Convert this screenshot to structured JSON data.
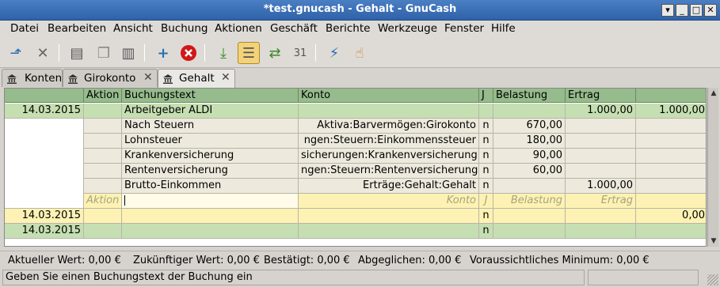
{
  "window": {
    "title": "*test.gnucash - Gehalt - GnuCash"
  },
  "colors": {
    "title_bar": "#3b6fb5",
    "header_green": "#96bb8c",
    "row_green": "#c6dfb2",
    "split_row": "#ede9dc",
    "input_row": "#fdf2b3",
    "close_red": "#d01818"
  },
  "menu": [
    "Datei",
    "Bearbeiten",
    "Ansicht",
    "Buchung",
    "Aktionen",
    "Geschäft",
    "Berichte",
    "Werkzeuge",
    "Fenster",
    "Hilfe"
  ],
  "toolbar_icons": [
    "save-icon",
    "close-icon",
    "new-invoice-icon",
    "duplicate-icon",
    "print-icon",
    "add-icon",
    "delete-icon",
    "enter-icon",
    "split-view-icon",
    "jump-icon",
    "schedule-icon",
    "transfer-icon",
    "reconcile-icon"
  ],
  "tabs": [
    {
      "label": "Konten"
    },
    {
      "label": "Girokonto"
    },
    {
      "label": "Gehalt"
    }
  ],
  "register": {
    "columns": [
      "",
      "Aktion",
      "Buchungstext",
      "Konto",
      "J",
      "Belastung",
      "Ertrag",
      ""
    ],
    "rows": [
      {
        "type": "transaction",
        "date": "14.03.2015",
        "action": "",
        "desc": "Arbeitgeber ALDI",
        "account": "",
        "r": "",
        "debit": "",
        "credit": "1.000,00",
        "balance": "1.000,00"
      },
      {
        "type": "split",
        "action": "",
        "desc": "Nach Steuern",
        "account": "Aktiva:Barvermögen:Girokonto",
        "r": "n",
        "debit": "670,00",
        "credit": ""
      },
      {
        "type": "split",
        "action": "",
        "desc": "Lohnsteuer",
        "account": "ngen:Steuern:Einkommenssteuer",
        "r": "n",
        "debit": "180,00",
        "credit": ""
      },
      {
        "type": "split",
        "action": "",
        "desc": "Krankenversicherung",
        "account": "sicherungen:Krankenversicherung",
        "r": "n",
        "debit": "90,00",
        "credit": ""
      },
      {
        "type": "split",
        "action": "",
        "desc": "Rentenversicherung",
        "account": "ngen:Steuern:Rentenversicherung",
        "r": "n",
        "debit": "60,00",
        "credit": ""
      },
      {
        "type": "split",
        "action": "",
        "desc": "Brutto-Einkommen",
        "account": "Erträge:Gehalt:Gehalt",
        "r": "n",
        "debit": "",
        "credit": "1.000,00"
      },
      {
        "type": "input",
        "action": "Aktion",
        "desc": "",
        "account": "Konto",
        "r": "J",
        "debit": "Belastung",
        "credit": "Ertrag"
      },
      {
        "type": "transaction-yellow",
        "date": "14.03.2015",
        "action": "",
        "desc": "",
        "account": "",
        "r": "n",
        "debit": "",
        "credit": "",
        "balance": "0,00"
      },
      {
        "type": "transaction",
        "date": "14.03.2015",
        "action": "",
        "desc": "",
        "account": "",
        "r": "n",
        "debit": "",
        "credit": "",
        "balance": ""
      }
    ]
  },
  "summary": {
    "current": "Aktueller Wert: 0,00 €",
    "future": "Zukünftiger Wert: 0,00 €",
    "cleared": "Bestätigt: 0,00 €",
    "reconciled": "Abgeglichen: 0,00 €",
    "projected_min": "Voraussichtliches Minimum: 0,00 €"
  },
  "status": {
    "text": "Geben Sie einen Buchungstext der Buchung ein"
  }
}
